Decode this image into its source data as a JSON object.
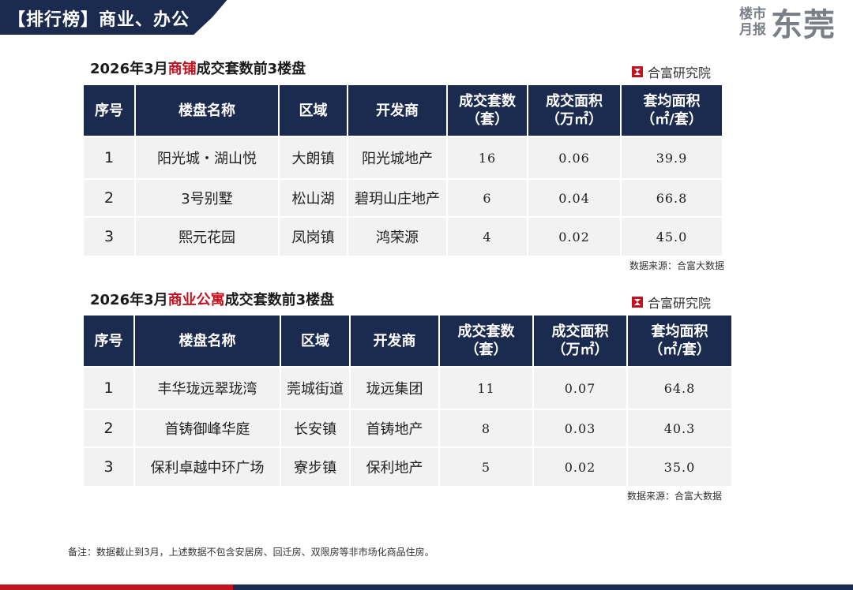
{
  "header": {
    "title": "【排行榜】商业、办公",
    "brand_small_1": "楼市",
    "brand_small_2": "月报",
    "brand_big": "东莞"
  },
  "colors": {
    "navy": "#1b2b4f",
    "red": "#c1121f",
    "row_bg": "#f2f2f2"
  },
  "section1": {
    "title_pre": "2026年3月",
    "title_highlight": "商铺",
    "title_post": "成交套数前3楼盘",
    "institute": "合富研究院",
    "source": "数据来源：合富大数据",
    "headers": [
      "序号",
      "楼盘名称",
      "区域",
      "开发商",
      "成交套数\n（套）",
      "成交面积\n（万㎡）",
      "套均面积\n（㎡/套）"
    ],
    "rows": [
      [
        "1",
        "阳光城・湖山悦",
        "大朗镇",
        "阳光城地产",
        "16",
        "0.06",
        "39.9"
      ],
      [
        "2",
        "3号别墅",
        "松山湖",
        "碧玥山庄地产",
        "6",
        "0.04",
        "66.8"
      ],
      [
        "3",
        "熙元花园",
        "凤岗镇",
        "鸿荣源",
        "4",
        "0.02",
        "45.0"
      ]
    ]
  },
  "section2": {
    "title_pre": "2026年3月",
    "title_highlight": "商业公寓",
    "title_post": "成交套数前3楼盘",
    "institute": "合富研究院",
    "source": "数据来源：合富大数据",
    "headers": [
      "序号",
      "楼盘名称",
      "区域",
      "开发商",
      "成交套数\n（套）",
      "成交面积\n（万㎡）",
      "套均面积\n（㎡/套）"
    ],
    "rows": [
      [
        "1",
        "丰华珑远翠珑湾",
        "莞城街道",
        "珑远集团",
        "11",
        "0.07",
        "64.8"
      ],
      [
        "2",
        "首铸御峰华庭",
        "长安镇",
        "首铸地产",
        "8",
        "0.03",
        "40.3"
      ],
      [
        "3",
        "保利卓越中环广场",
        "寮步镇",
        "保利地产",
        "5",
        "0.02",
        "35.0"
      ]
    ]
  },
  "note": "备注：数据截止到3月，上述数据不包含安居房、回迁房、双限房等非市场化商品住房。"
}
